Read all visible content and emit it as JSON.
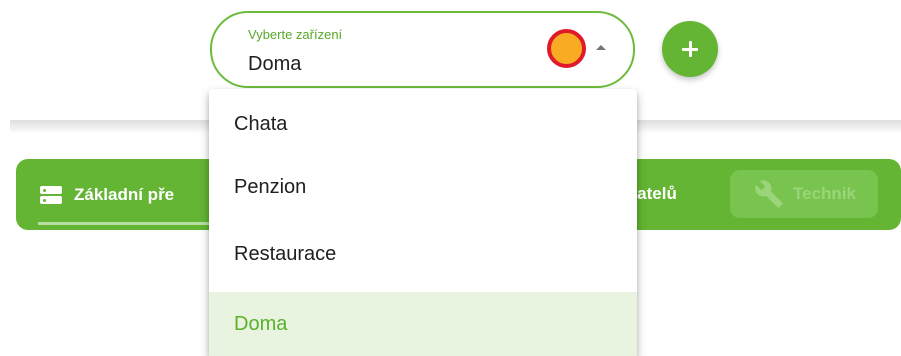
{
  "device_select": {
    "label": "Vyberte zařízení",
    "value": "Doma",
    "status_icon": "status-dot",
    "status_colors": {
      "fill": "#f8ab23",
      "ring": "#e0192b"
    }
  },
  "add_button": {
    "icon": "plus-icon"
  },
  "nav": {
    "basic_label": "Základní pře",
    "basic_icon": "server-icon",
    "users_label": "ivatelů",
    "technik_label": "Technik",
    "technik_icon": "wrench-icon"
  },
  "dropdown": {
    "options": [
      "Chata",
      "Penzion",
      "Restaurace",
      "Doma"
    ],
    "selected": "Doma"
  },
  "colors": {
    "accent": "#63b533",
    "selected_bg": "#e8f3e0",
    "selected_text": "#5ab12c"
  }
}
